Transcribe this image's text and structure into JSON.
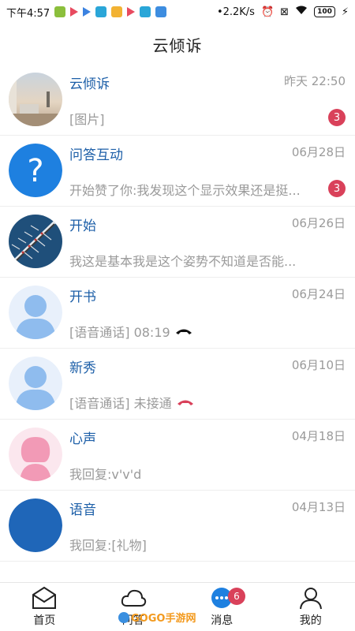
{
  "status_bar": {
    "time": "下午4:57",
    "net_speed": "•2.2K/s",
    "battery": "100"
  },
  "header": {
    "title": "云倾诉"
  },
  "conversations": [
    {
      "name": "云倾诉",
      "time": "昨天 22:50",
      "preview": "[图片]",
      "badge": "3",
      "avatar": "photo-window"
    },
    {
      "name": "问答互动",
      "time": "06月28日",
      "preview": "开始赞了你:我发现这个显示效果还是挺...",
      "badge": "3",
      "avatar": "question-mark"
    },
    {
      "name": "开始",
      "time": "06月26日",
      "preview": "我这是基本我是这个姿势不知道是否能...",
      "badge": "",
      "avatar": "photo-rowing"
    },
    {
      "name": "开书",
      "time": "06月24日",
      "preview": "[语音通话] 08:19",
      "badge": "",
      "avatar": "default-user",
      "call_icon_color": "#111111"
    },
    {
      "name": "新秀",
      "time": "06月10日",
      "preview": "[语音通话] 未接通",
      "badge": "",
      "avatar": "default-user",
      "call_icon_color": "#d9415a"
    },
    {
      "name": "心声",
      "time": "04月18日",
      "preview": "我回复:v'v'd",
      "badge": "",
      "avatar": "default-user-pink"
    },
    {
      "name": "语音",
      "time": "04月13日",
      "preview": "我回复:[礼物]",
      "badge": "",
      "avatar": "solid-blue"
    }
  ],
  "tabs": [
    {
      "label": "首页",
      "icon": "home-mail-icon"
    },
    {
      "label": "问答",
      "icon": "cloud-icon"
    },
    {
      "label": "消息",
      "icon": "chat-icon",
      "badge": "6"
    },
    {
      "label": "我的",
      "icon": "person-icon"
    }
  ],
  "watermark": {
    "text": "GOGO手游网"
  },
  "colors": {
    "accent_blue": "#1d5fa8",
    "badge_red": "#d9415a",
    "gray_text": "#9a9a9a"
  }
}
